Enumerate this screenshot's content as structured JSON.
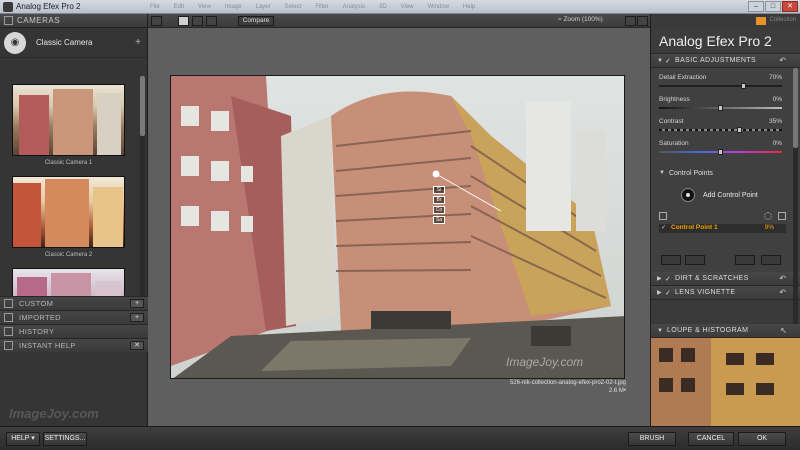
{
  "window": {
    "title": "Analog Efex Pro 2",
    "minimize": "–",
    "maximize": "□",
    "close": "✕"
  },
  "menu_strip": [
    "File",
    "Edit",
    "View",
    "Image",
    "Layer",
    "Select",
    "Filter",
    "Analysis",
    "3D",
    "View",
    "Window",
    "Help"
  ],
  "left_panel": {
    "cameras_header": "CAMERAS",
    "camera_name": "Classic Camera",
    "add_label": "+",
    "presets": [
      {
        "label": "Classic Camera 1"
      },
      {
        "label": "Classic Camera 2"
      },
      {
        "label": ""
      }
    ],
    "sections": [
      {
        "label": "CUSTOM",
        "button": "+"
      },
      {
        "label": "IMPORTED",
        "button": "+"
      },
      {
        "label": "HISTORY",
        "button": ""
      },
      {
        "label": "INSTANT HELP",
        "button": "✕"
      }
    ],
    "watermark": "ImageJoy.com"
  },
  "toolbar": {
    "compare_label": "Compare",
    "zoom_label": "Zoom (100%)"
  },
  "canvas": {
    "file_name": "526-nik-collection-analog-efex-pro2-02-t.jpg",
    "file_size": "2.6 M•",
    "photo_watermark": "ImageJoy.com"
  },
  "right_panel": {
    "brand": "Collection",
    "app_title": "Analog Efex Pro 2",
    "basic_adjustments": "BASIC ADJUSTMENTS",
    "sliders": [
      {
        "name": "Detail Extraction",
        "value": "70%",
        "level": 0.7
      },
      {
        "name": "Brightness",
        "value": "0%",
        "level": 0.5
      },
      {
        "name": "Contrast",
        "value": "35%",
        "level": 0.67
      },
      {
        "name": "Saturation",
        "value": "0%",
        "level": 0.5
      }
    ],
    "control_points_header": "Control Points",
    "add_control_point": "Add Control Point",
    "control_point_name": "Control Point 1",
    "control_point_value": "9%",
    "dirt_scratches": "DIRT & SCRATCHES",
    "lens_vignette": "LENS VIGNETTE",
    "loupe_histogram": "LOUPE & HISTOGRAM"
  },
  "bottom_bar": {
    "help": "HELP ▾",
    "settings": "SETTINGS...",
    "brush": "BRUSH",
    "cancel": "CANCEL",
    "ok": "OK"
  },
  "colors": {
    "accent": "#f0a400",
    "panel_bg": "#3a3a3a",
    "canvas_bg": "#5f5f5f"
  }
}
